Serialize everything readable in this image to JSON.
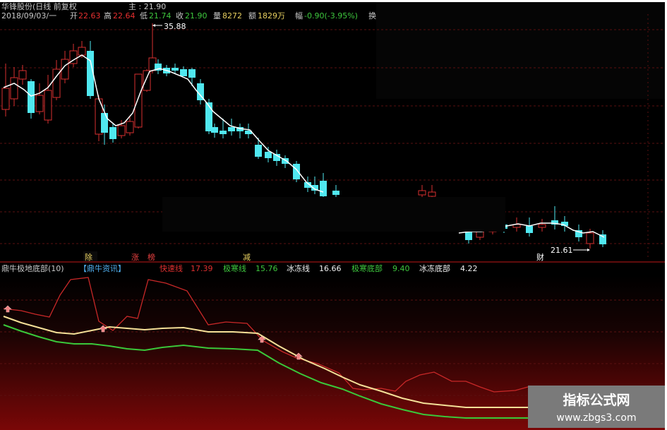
{
  "header": {
    "stock": "华锋股份(日线 前复权",
    "main_label": "主 : 21.90",
    "date": "2018/09/03/一",
    "open_label": "开",
    "open": "22.63",
    "high_label": "高",
    "high": "22.64",
    "low_label": "低",
    "low": "21.74",
    "close_label": "收",
    "close": "21.90",
    "volume_label": "量",
    "volume": "8272",
    "amount_label": "额",
    "amount": "1829万",
    "change_label": "幅",
    "change": "-0.90(-3.95%)",
    "trailing": "换"
  },
  "price_chart": {
    "high_annotation": "35.88",
    "low_annotation": "21.61",
    "event_markers": [
      "除",
      "涨",
      "榜",
      "减",
      "财"
    ]
  },
  "indicator": {
    "name": "鼎牛极地底部(10)",
    "source": "【鼎牛资讯】",
    "lines": [
      {
        "label": "快速线",
        "value": "17.39",
        "color": "#e03030"
      },
      {
        "label": "极寒线",
        "value": "15.76",
        "color": "#3ec83e"
      },
      {
        "label": "冰冻线",
        "value": "16.66",
        "color": "#f0e08a"
      },
      {
        "label": "极寒底部",
        "value": "9.40",
        "color": "#3ec83e"
      },
      {
        "label": "冰冻底部",
        "value": "4.22",
        "color": "#f0e08a"
      }
    ]
  },
  "watermark": {
    "title": "指标公式网",
    "url": "www.zbgs3.com"
  },
  "colors": {
    "up": "#d83030",
    "down": "#50e8f0",
    "ma": "#ffffff",
    "background": "#000000"
  }
}
